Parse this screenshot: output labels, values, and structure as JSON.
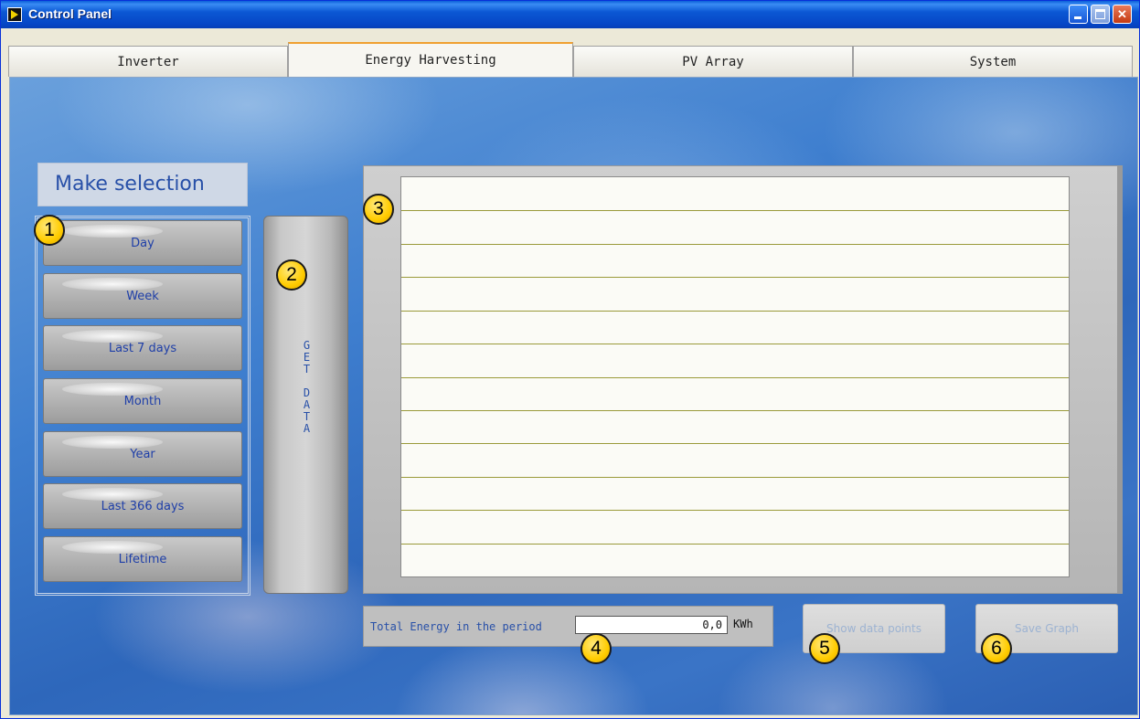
{
  "window": {
    "title": "Control Panel",
    "icon": "labview-run-icon",
    "controls": [
      "minimize-icon",
      "maximize-icon",
      "close-icon"
    ]
  },
  "tabs": [
    {
      "label": "Inverter",
      "active": false
    },
    {
      "label": "Energy Harvesting",
      "active": true
    },
    {
      "label": "PV Array",
      "active": false
    },
    {
      "label": "System",
      "active": false
    }
  ],
  "selection": {
    "title": "Make selection",
    "options": [
      "Day",
      "Week",
      "Last 7 days",
      "Month",
      "Year",
      "Last 366 days",
      "Lifetime"
    ]
  },
  "get_data": {
    "label": "G\nE\nT\n\nD\nA\nT\nA"
  },
  "graph": {
    "gridline_count": 11,
    "gridline_color": "#9a9a3a"
  },
  "total": {
    "label": "Total Energy in the period",
    "value": "0,0",
    "unit": "KWh"
  },
  "buttons": {
    "show_points": {
      "label": "Show data points",
      "enabled": false
    },
    "save_graph": {
      "label": "Save Graph",
      "enabled": false
    }
  },
  "callouts": [
    "1",
    "2",
    "3",
    "4",
    "5",
    "6"
  ],
  "colors": {
    "label_blue": "#2850a8",
    "badge_yellow": "#ffcc00",
    "titlebar_blue": "#0b58d4"
  }
}
